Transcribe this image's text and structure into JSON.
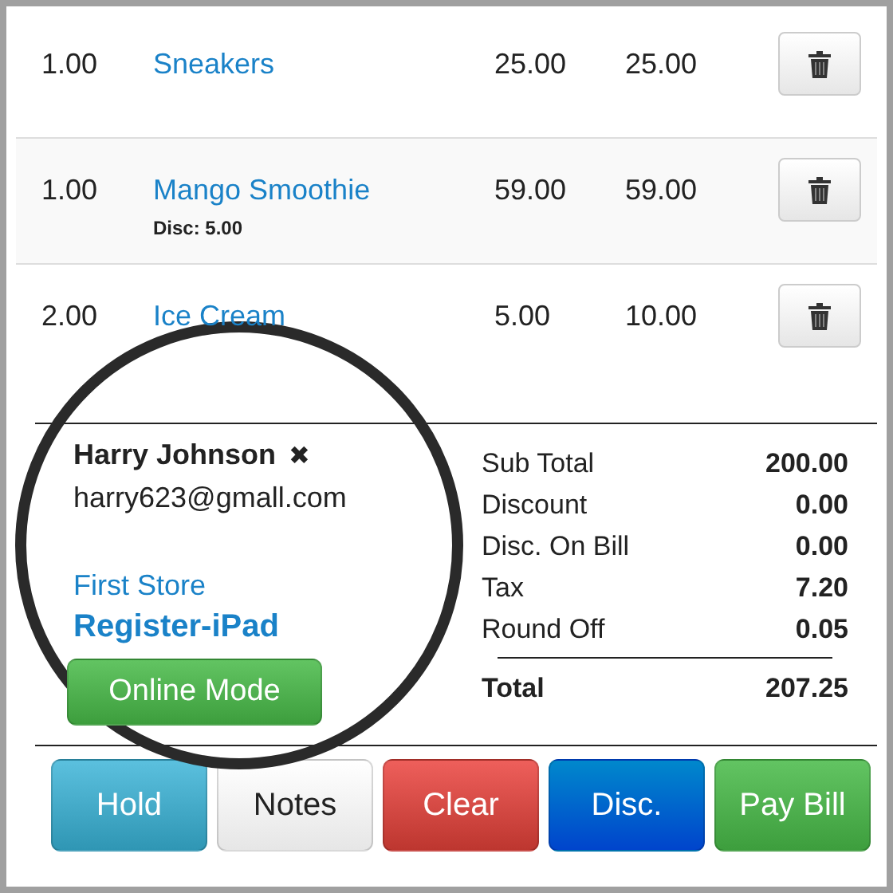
{
  "items": [
    {
      "qty": "1.00",
      "name": "Sneakers",
      "price": "25.00",
      "total": "25.00"
    },
    {
      "qty": "1.00",
      "name": "Mango Smoothie",
      "discount": "Disc: 5.00",
      "price": "59.00",
      "total": "59.00"
    },
    {
      "qty": "2.00",
      "name": "Ice Cream",
      "price": "5.00",
      "total": "10.00"
    }
  ],
  "customer": {
    "name": "Harry Johnson",
    "remove_icon": "✖",
    "email": "harry623@gmall.com",
    "store": "First Store",
    "register": "Register-iPad",
    "mode_button": "Online Mode"
  },
  "totals": [
    {
      "label": "Sub Total",
      "value": "200.00"
    },
    {
      "label": "Discount",
      "value": "0.00"
    },
    {
      "label": "Disc. On Bill",
      "value": "0.00"
    },
    {
      "label": "Tax",
      "value": "7.20"
    },
    {
      "label": "Round Off",
      "value": "0.05"
    }
  ],
  "grand_total": {
    "label": "Total",
    "value": "207.25"
  },
  "actions": [
    {
      "label": "Hold",
      "kind": "info"
    },
    {
      "label": "Notes",
      "kind": "default"
    },
    {
      "label": "Clear",
      "kind": "danger"
    },
    {
      "label": "Disc.",
      "kind": "primary"
    },
    {
      "label": "Pay Bill",
      "kind": "success"
    }
  ]
}
